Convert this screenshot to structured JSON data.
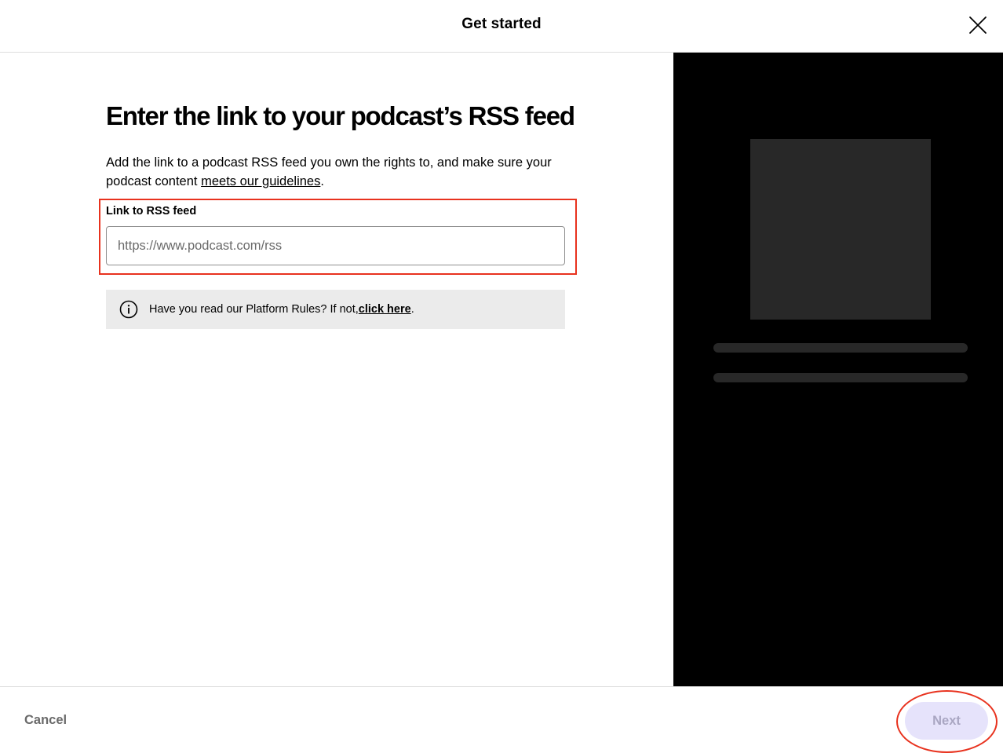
{
  "header": {
    "title": "Get started",
    "close_icon": "close-icon"
  },
  "main": {
    "heading": "Enter the link to your podcast’s RSS feed",
    "description_part1": "Add the link to a podcast RSS feed you own the rights to, and make sure your podcast content ",
    "description_link": "meets our guidelines",
    "description_end": ".",
    "field": {
      "label": "Link to RSS feed",
      "value": "",
      "placeholder": "https://www.podcast.com/rss"
    },
    "info": {
      "icon": "info-icon",
      "text": "Have you read our Platform Rules? If not, ",
      "link": "click here",
      "end": "."
    }
  },
  "preview": {
    "background": "#000000",
    "placeholder_color": "#282828"
  },
  "footer": {
    "cancel_label": "Cancel",
    "next_label": "Next",
    "next_disabled": true
  },
  "colors": {
    "highlight": "#e8321e",
    "next_bg": "#e6e3fb",
    "next_text": "#a9a6c2"
  }
}
